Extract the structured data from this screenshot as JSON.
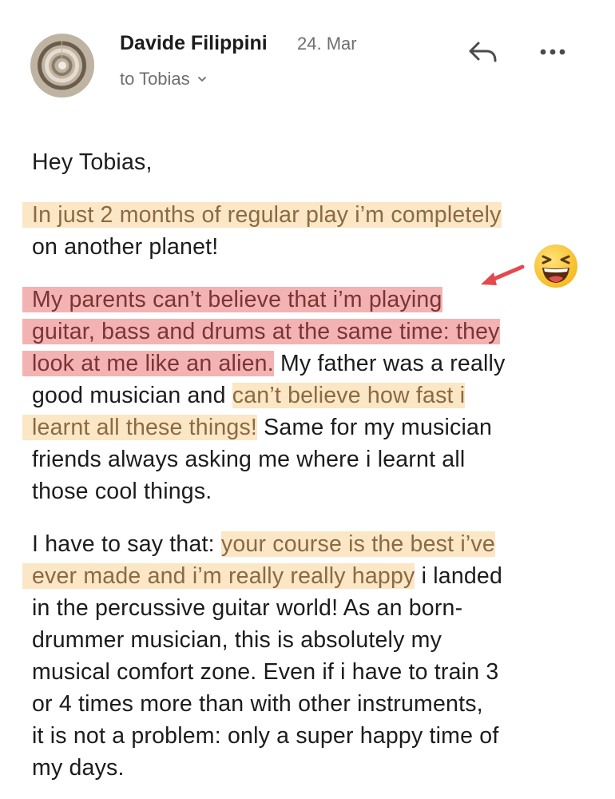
{
  "header": {
    "sender_name": "Davide Filippini",
    "date": "24. Mar",
    "recipient": "to Tobias",
    "icons": {
      "avatar": "avatar",
      "reply": "reply-icon",
      "more": "more-icon",
      "dropdown": "chevron-down-icon"
    }
  },
  "message": {
    "greeting": "Hey Tobias,",
    "p1": {
      "l1": "In just 2 months of regular play i’m completely",
      "l2": "on another planet!"
    },
    "p2": {
      "l1": "My parents can’t believe that i’m playing",
      "l2": "guitar, bass and drums at the same time: they",
      "l3a": "look at me like an alien.",
      "l3b": " My father was a really",
      "l4a": "good musician and ",
      "l4b": "can’t believe how fast i",
      "l5a": "learnt all these things!",
      "l5b": " Same for my musician",
      "l6": "friends always asking me where i learnt all",
      "l7": "those cool things."
    },
    "p3": {
      "l1a": "I have to say that: ",
      "l1b": "your course is the best i’ve",
      "l2a": "ever made and i’m really really happy",
      "l2b": " i landed",
      "l3": "in the percussive guitar world! As an born-",
      "l4": "drummer musician, this is absolutely my",
      "l5": "musical comfort zone. Even if i have to train 3",
      "l6": "or 4 times more than with other instruments,",
      "l7": "it is not a problem: only a super happy time of",
      "l8": "my days."
    }
  },
  "annotations": {
    "highlight_yellow": "#fbe6c6",
    "highlight_red": "#f4b3b3",
    "arrow_color": "#e5484d",
    "emoji": "laughing-face-emoji"
  }
}
